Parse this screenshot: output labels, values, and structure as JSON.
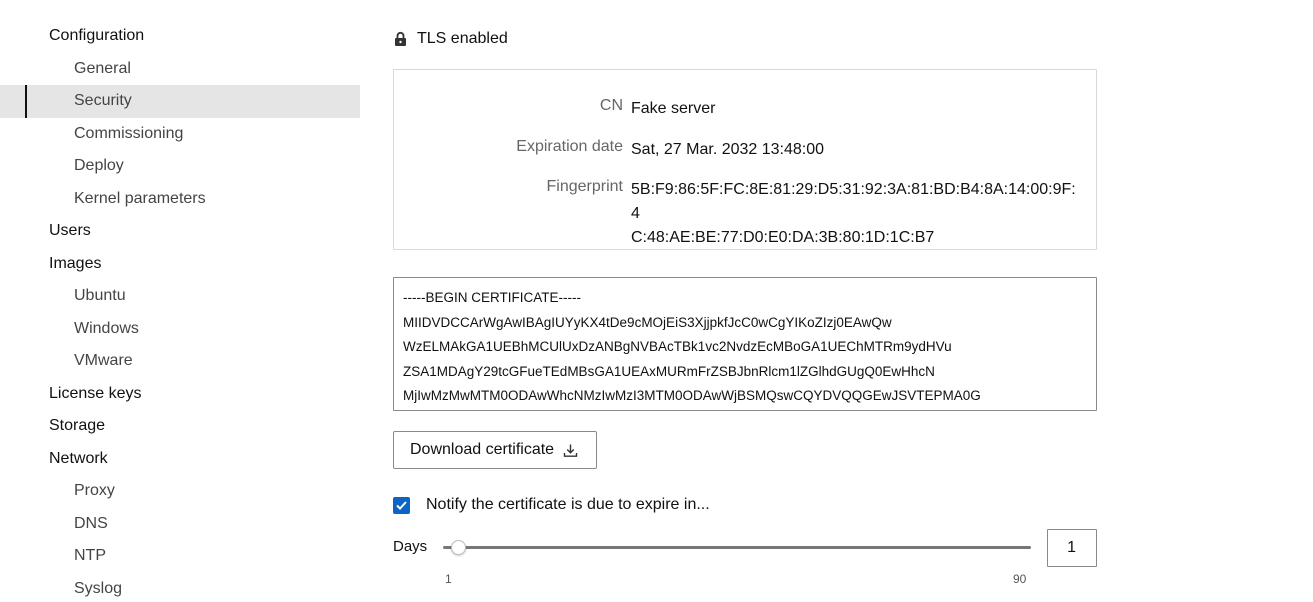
{
  "sidebar": {
    "items": [
      {
        "label": "Configuration",
        "level": "top",
        "active": false
      },
      {
        "label": "General",
        "level": "sub",
        "active": false
      },
      {
        "label": "Security",
        "level": "sub",
        "active": true
      },
      {
        "label": "Commissioning",
        "level": "sub",
        "active": false
      },
      {
        "label": "Deploy",
        "level": "sub",
        "active": false
      },
      {
        "label": "Kernel parameters",
        "level": "sub",
        "active": false
      },
      {
        "label": "Users",
        "level": "top",
        "active": false
      },
      {
        "label": "Images",
        "level": "top",
        "active": false
      },
      {
        "label": "Ubuntu",
        "level": "sub",
        "active": false
      },
      {
        "label": "Windows",
        "level": "sub",
        "active": false
      },
      {
        "label": "VMware",
        "level": "sub",
        "active": false
      },
      {
        "label": "License keys",
        "level": "top",
        "active": false
      },
      {
        "label": "Storage",
        "level": "top",
        "active": false
      },
      {
        "label": "Network",
        "level": "top",
        "active": false
      },
      {
        "label": "Proxy",
        "level": "sub",
        "active": false
      },
      {
        "label": "DNS",
        "level": "sub",
        "active": false
      },
      {
        "label": "NTP",
        "level": "sub",
        "active": false
      },
      {
        "label": "Syslog",
        "level": "sub",
        "active": false
      }
    ]
  },
  "tls": {
    "status_label": "TLS enabled",
    "icon": "lock-icon"
  },
  "certificate": {
    "cn_label": "CN",
    "cn_value": "Fake server",
    "expiration_label": "Expiration date",
    "expiration_value": "Sat, 27 Mar. 2032 13:48:00",
    "fingerprint_label": "Fingerprint",
    "fingerprint_line1": "5B:F9:86:5F:FC:8E:81:29:D5:31:92:3A:81:BD:B4:8A:14:00:9F:4",
    "fingerprint_line2": "C:48:AE:BE:77:D0:E0:DA:3B:80:1D:1C:B7",
    "pem_text": "-----BEGIN CERTIFICATE-----\nMIIDVDCCArWgAwIBAgIUYyKX4tDe9cMOjEiS3XjjpkfJcC0wCgYIKoZIzj0EAwQw\nWzELMAkGA1UEBhMCUlUxDzANBgNVBAcTBk1vc2NvdzEcMBoGA1UEChMTRm9ydHVu\nZSA1MDAgY29tcGFueTEdMBsGA1UEAxMURmFrZSBJbnRlcm1lZGlhdGUgQ0EwHhcN\nMjIwMzMwMTM0ODAwWhcNMzIwMzI3MTM0ODAwWjBSMQswCQYDVQQGEwJSVTEPMA0G"
  },
  "download": {
    "label": "Download certificate",
    "icon": "download-icon"
  },
  "notify": {
    "label": "Notify the certificate is due to expire in...",
    "checked": true,
    "accent_color": "#0b66c3"
  },
  "days": {
    "label": "Days",
    "value": "1",
    "min_label": "1",
    "max_label": "90",
    "min": 1,
    "max": 90
  }
}
